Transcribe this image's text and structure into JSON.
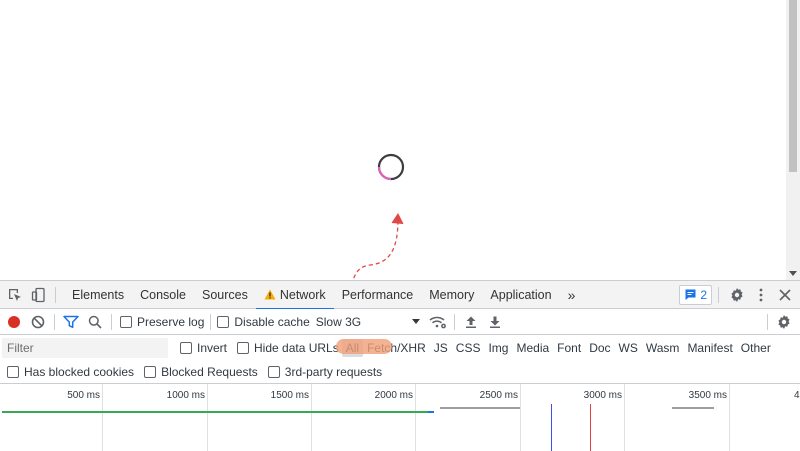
{
  "main_tabs": [
    {
      "label": "Elements"
    },
    {
      "label": "Console"
    },
    {
      "label": "Sources"
    },
    {
      "label": "Network",
      "active": true,
      "warning": true
    },
    {
      "label": "Performance"
    },
    {
      "label": "Memory"
    },
    {
      "label": "Application"
    }
  ],
  "more_tabs": "»",
  "issues_count": "2",
  "toolbar": {
    "preserve_log": "Preserve log",
    "disable_cache": "Disable cache",
    "throttling": "Slow 3G"
  },
  "filter": {
    "placeholder": "Filter",
    "invert": "Invert",
    "hide_data_urls": "Hide data URLs",
    "types": [
      "All",
      "Fetch/XHR",
      "JS",
      "CSS",
      "Img",
      "Media",
      "Font",
      "Doc",
      "WS",
      "Wasm",
      "Manifest",
      "Other"
    ],
    "active_type": "All"
  },
  "blocked": {
    "has_blocked_cookies": "Has blocked cookies",
    "blocked_requests": "Blocked Requests",
    "third_party": "3rd-party requests"
  },
  "timeline": {
    "ticks": [
      "500 ms",
      "1000 ms",
      "1500 ms",
      "2000 ms",
      "2500 ms",
      "3000 ms",
      "3500 ms",
      "4"
    ]
  },
  "colors": {
    "accent": "#1a73e8",
    "record": "#d93025",
    "warning": "#f9ab00",
    "loading_bar": "#34a853",
    "dom_content_loaded": "#3c4ff0",
    "load_event": "#e04040",
    "annotation": "#e04848",
    "highlight": "#f0a078"
  }
}
